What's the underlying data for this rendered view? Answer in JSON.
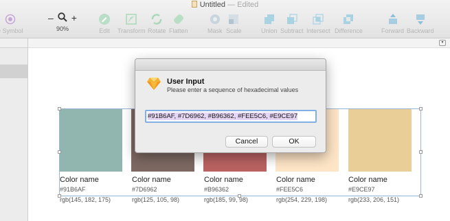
{
  "window": {
    "title": "Untitled",
    "edited_suffix": "— Edited"
  },
  "toolbar": {
    "create_symbol": "e Symbol",
    "zoom_minus": "–",
    "zoom_plus": "+",
    "zoom_level": "90%",
    "items": [
      {
        "label": "Edit"
      },
      {
        "label": "Transform"
      },
      {
        "label": "Rotate"
      },
      {
        "label": "Flatten"
      },
      {
        "label": "Mask"
      },
      {
        "label": "Scale"
      },
      {
        "label": "Union"
      },
      {
        "label": "Subtract"
      },
      {
        "label": "Intersect"
      },
      {
        "label": "Difference"
      },
      {
        "label": "Forward"
      },
      {
        "label": "Backward"
      }
    ]
  },
  "swatches": [
    {
      "name": "Color name",
      "hex": "#91B6AF",
      "rgb": "rgb(145, 182, 175)",
      "color": "#91B6AF"
    },
    {
      "name": "Color name",
      "hex": "#7D6962",
      "rgb": "rgb(125, 105, 98)",
      "color": "#7D6962"
    },
    {
      "name": "Color name",
      "hex": "#B96362",
      "rgb": "rgb(185, 99, 98)",
      "color": "#B96362"
    },
    {
      "name": "Color name",
      "hex": "#FEE5C6",
      "rgb": "rgb(254, 229, 198)",
      "color": "#FEE5C6"
    },
    {
      "name": "Color name",
      "hex": "#E9CE97",
      "rgb": "rgb(233, 206, 151)",
      "color": "#E9CE97"
    }
  ],
  "dialog": {
    "title": "User Input",
    "message": "Please enter a sequence of hexadecimal values",
    "input_value": "#91B6AF, #7D6962, #B96362, #FEE5C6, #E9CE97",
    "cancel_label": "Cancel",
    "ok_label": "OK"
  },
  "colors": {
    "accent": "#82AEE6",
    "selection": "#9AB4D3",
    "input_highlight": "#E6D6F6"
  },
  "icons": {
    "app_icon": "sketch-diamond-icon"
  }
}
